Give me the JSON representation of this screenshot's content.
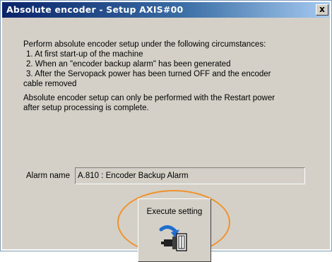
{
  "window": {
    "title": "Absolute encoder - Setup AXIS#00",
    "close_label": "x"
  },
  "description": {
    "intro": "Perform absolute encoder setup under the following circumstances:",
    "items": [
      "1. At first start-up of the machine",
      "2. When an \"encoder backup alarm\" has been generated",
      "3. After the Servopack power has been turned OFF and the encoder"
    ],
    "item3_cont": "cable removed",
    "note_line1": "Absolute encoder setup can only be performed with the Restart power",
    "note_line2": "after setup processing is complete."
  },
  "alarm": {
    "label": "Alarm name",
    "value": "A.810 : Encoder Backup Alarm"
  },
  "execute_button": {
    "label": "Execute setting",
    "icon": "encoder-setup-icon"
  },
  "colors": {
    "titlebar_start": "#0a246a",
    "titlebar_end": "#a6caf0",
    "highlight": "#f0922b",
    "face": "#d4d0c8"
  }
}
